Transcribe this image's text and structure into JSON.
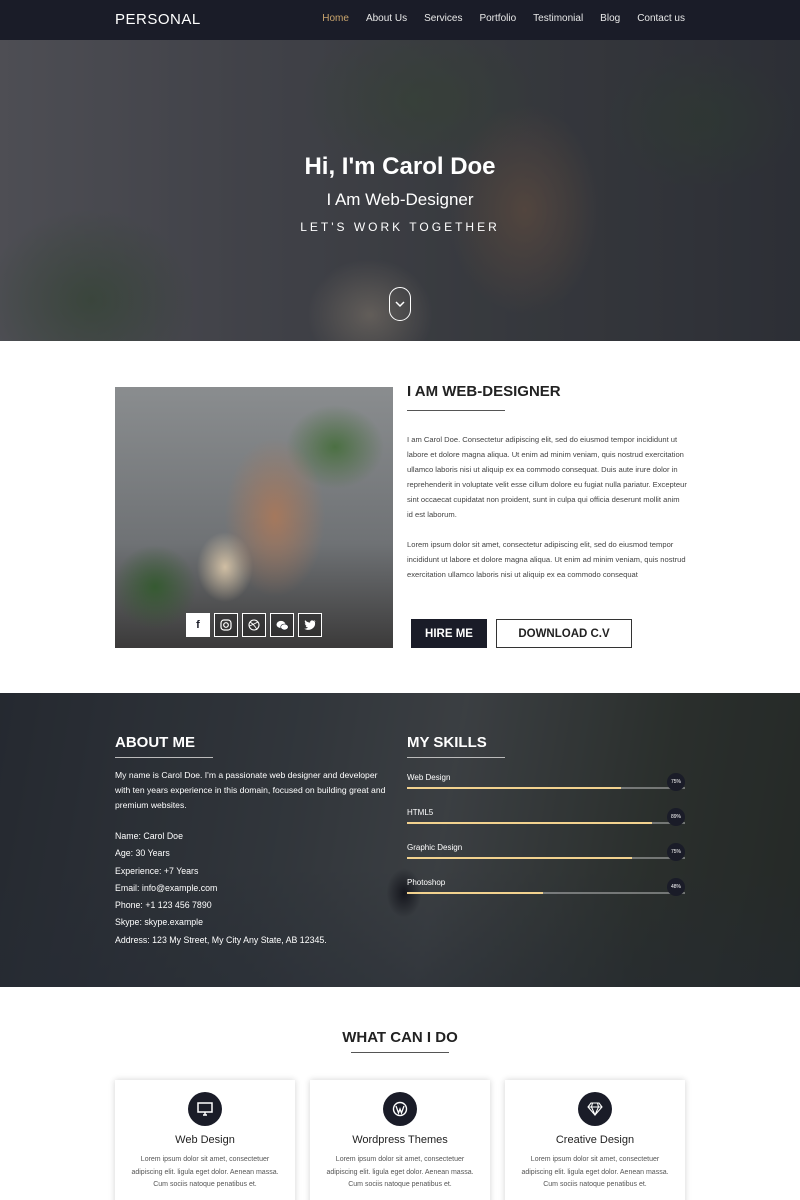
{
  "nav": {
    "brand": "PERSONAL",
    "items": [
      "Home",
      "About Us",
      "Services",
      "Portfolio",
      "Testimonial",
      "Blog",
      "Contact us"
    ],
    "active": "Home"
  },
  "hero": {
    "title": "Hi, I'm Carol Doe",
    "subtitle": "I Am Web-Designer",
    "tagline": "LET'S WORK TOGETHER"
  },
  "intro": {
    "heading": "I AM WEB-DESIGNER",
    "para1": "I am Carol Doe. Consectetur adipiscing elit, sed do eiusmod tempor incididunt ut labore et dolore magna aliqua. Ut enim ad minim veniam, quis nostrud exercitation ullamco laboris nisi ut aliquip ex ea commodo consequat. Duis aute irure dolor in reprehenderit in voluptate velit esse cillum dolore eu fugiat nulla pariatur. Excepteur sint occaecat cupidatat non proident, sunt in culpa qui officia deserunt mollit anim id est laborum.",
    "para2": "Lorem ipsum dolor sit amet, consectetur adipiscing elit, sed do eiusmod tempor incididunt ut labore et dolore magna aliqua. Ut enim ad minim veniam, quis nostrud exercitation ullamco laboris nisi ut aliquip ex ea commodo consequat",
    "hire_label": "HIRE ME",
    "cv_label": "DOWNLOAD C.V",
    "social_icons": [
      "facebook-icon",
      "instagram-icon",
      "dribbble-icon",
      "wechat-icon",
      "twitter-icon"
    ]
  },
  "about": {
    "heading": "ABOUT ME",
    "text": "My name is Carol Doe. I'm a passionate web designer and developer with ten years experience in this domain, focused on building great and premium websites.",
    "details": [
      "Name: Carol Doe",
      "Age: 30 Years",
      "Experience: +7 Years",
      "Email: info@example.com",
      "Phone: +1 123 456 7890",
      "Skype: skype.example",
      "Address: 123 My Street, My City Any State, AB 12345."
    ]
  },
  "skills": {
    "heading": "MY SKILLS",
    "items": [
      {
        "name": "Web Design",
        "label": "75%",
        "value": 0.77
      },
      {
        "name": "HTML5",
        "label": "89%",
        "value": 0.88
      },
      {
        "name": "Graphic Design",
        "label": "75%",
        "value": 0.81
      },
      {
        "name": "Photoshop",
        "label": "48%",
        "value": 0.49
      }
    ],
    "bar_color": "#f2d28f"
  },
  "services": {
    "heading": "WHAT CAN I DO",
    "cards": [
      {
        "title": "Web Design",
        "icon": "monitor-icon",
        "text": "Lorem ipsum dolor sit amet, consectetuer adipiscing elit. ligula eget dolor. Aenean massa. Cum sociis natoque penatibus et."
      },
      {
        "title": "Wordpress Themes",
        "icon": "wordpress-icon",
        "text": "Lorem ipsum dolor sit amet, consectetuer adipiscing elit. ligula eget dolor. Aenean massa. Cum sociis natoque penatibus et."
      },
      {
        "title": "Creative Design",
        "icon": "diamond-icon",
        "text": "Lorem ipsum dolor sit amet, consectetuer adipiscing elit. ligula eget dolor. Aenean massa. Cum sociis natoque penatibus et."
      }
    ]
  },
  "colors": {
    "dark": "#1a1c28",
    "accent": "#c9a46c"
  }
}
